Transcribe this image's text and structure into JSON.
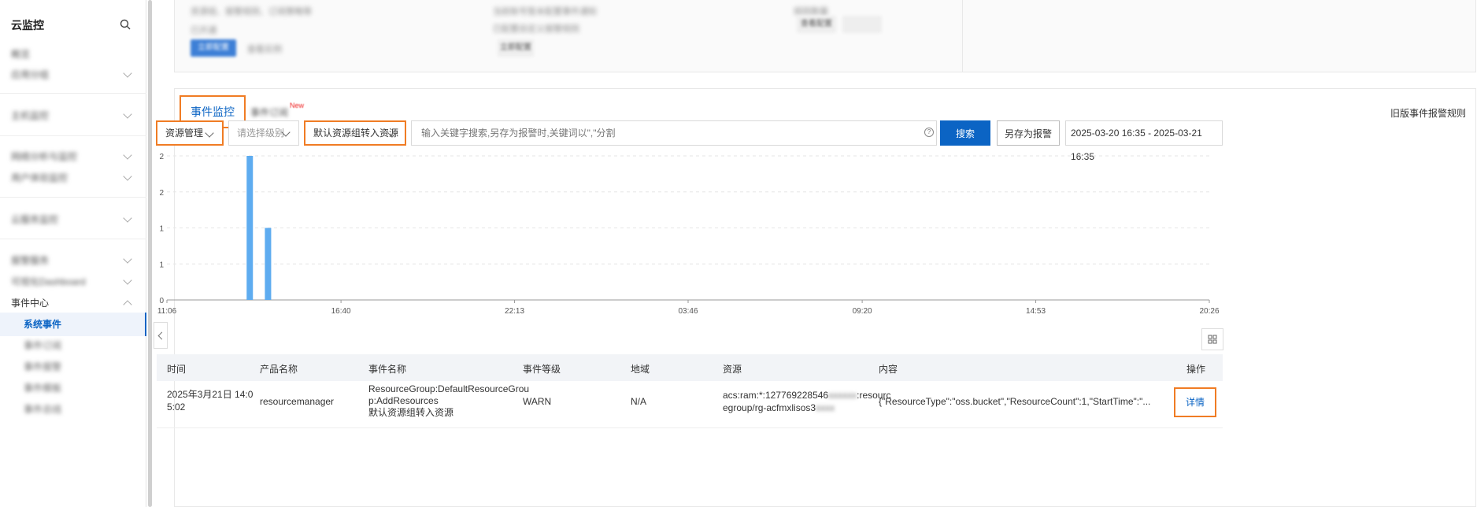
{
  "sidebar": {
    "title": "云监控",
    "items": [
      {
        "label": "概览"
      },
      {
        "label": "应用分组"
      },
      {
        "label": "主机监控"
      },
      {
        "label": "网络分析与监控"
      },
      {
        "label": "用户体验监控"
      },
      {
        "label": "云服务监控"
      },
      {
        "label": "报警服务"
      },
      {
        "label": "可视化Dashboard"
      },
      {
        "label": "事件中心"
      }
    ],
    "sub_items": [
      {
        "label": "系统事件"
      },
      {
        "label": "事件订阅"
      },
      {
        "label": "事件报警"
      },
      {
        "label": "事件模板"
      },
      {
        "label": "事件总线"
      }
    ]
  },
  "top_panel": {
    "texts": [
      "资源组、报警规则、订阅策略等",
      "已开通",
      "当前账号暂未配置事件通知",
      "已配置自定义报警规则",
      "规则数量"
    ],
    "buttons": [
      "立即配置",
      "查看实例",
      "立即配置",
      "查看配置"
    ]
  },
  "tabs": {
    "active": "事件监控",
    "other": "事件订阅",
    "badge": "New",
    "old_rules": "旧版事件报警规则"
  },
  "filters": {
    "product": "资源管理",
    "level_placeholder": "请选择级别",
    "event_name": "默认资源组转入资源",
    "keyword_placeholder": "输入关键字搜索,另存为报警时,关键词以\",\"分割",
    "help": "?",
    "search_label": "搜索",
    "save_label": "另存为报警",
    "date_range": "2025-03-20 16:35 - 2025-03-21 16:35"
  },
  "chart_data": {
    "type": "bar",
    "y_ticks": [
      "2",
      "2",
      "1",
      "1",
      "0"
    ],
    "x_ticks": [
      "11:06",
      "16:40",
      "22:13",
      "03:46",
      "09:20",
      "14:53",
      "20:26"
    ],
    "ylim": [
      0,
      2
    ],
    "bars": [
      {
        "time": "13:45",
        "value": 2
      },
      {
        "time": "14:20",
        "value": 1
      }
    ],
    "bar_color": "#5eacf0",
    "grid": true
  },
  "table": {
    "headers": [
      "时间",
      "产品名称",
      "事件名称",
      "事件等级",
      "地域",
      "资源",
      "内容",
      "操作"
    ],
    "rows": [
      {
        "time": [
          "2025年3月21日 14:0",
          "5:02"
        ],
        "product": "resourcemanager",
        "event_name": [
          "ResourceGroup:DefaultResourceGrou",
          "p:AddResources",
          "默认资源组转入资源"
        ],
        "level": "WARN",
        "region": "N/A",
        "resource_line1": "acs:ram:*:127769228546",
        "resource_line1_hidden": "xxxxxx",
        "resource_line1_tail": ":resourc",
        "resource_line2": "egroup/rg-acfmxlisos3",
        "resource_line2_hidden": "xxxx",
        "content": "{\"ResourceType\":\"oss.bucket\",\"ResourceCount\":1,\"StartTime\":\"...",
        "action": "详情"
      }
    ]
  }
}
